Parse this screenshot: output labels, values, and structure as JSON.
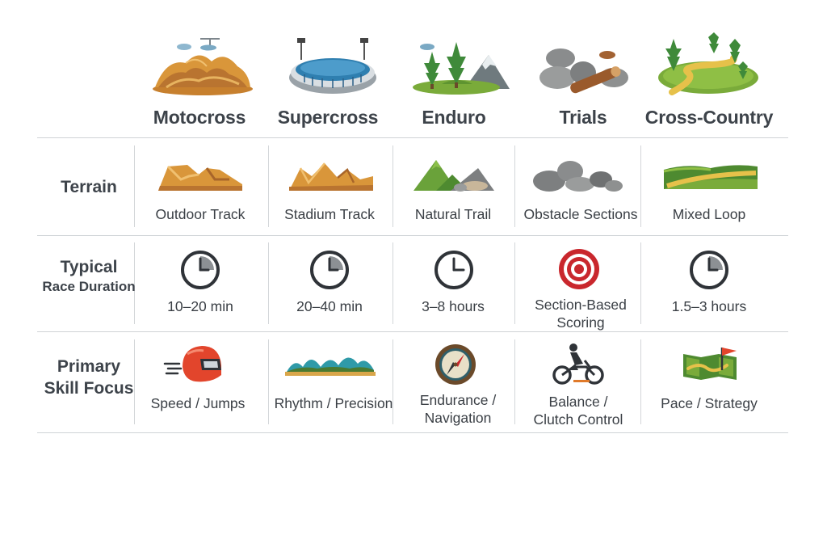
{
  "columns": [
    {
      "label": "Motocross",
      "icon": "dirt-hills-icon"
    },
    {
      "label": "Supercross",
      "icon": "stadium-icon"
    },
    {
      "label": "Enduro",
      "icon": "mountain-forest-icon"
    },
    {
      "label": "Trials",
      "icon": "rocks-logs-icon"
    },
    {
      "label": "Cross-Country",
      "icon": "winding-path-icon"
    }
  ],
  "rows": {
    "terrain": {
      "label": "Terrain",
      "cells": [
        {
          "text": "Outdoor Track",
          "icon": "dirt-track-icon"
        },
        {
          "text": "Stadium Track",
          "icon": "stadium-track-icon"
        },
        {
          "text": "Natural Trail",
          "icon": "natural-trail-icon"
        },
        {
          "text": "Obstacle Sections",
          "icon": "rocks-icon"
        },
        {
          "text": "Mixed Loop",
          "icon": "mixed-loop-icon"
        }
      ]
    },
    "duration": {
      "label_line1": "Typical",
      "label_line2": "Race Duration",
      "cells": [
        {
          "text": "10–20 min",
          "icon": "clock-icon"
        },
        {
          "text": "20–40 min",
          "icon": "clock-icon"
        },
        {
          "text": "3–8 hours",
          "icon": "clock-icon"
        },
        {
          "text_line1": "Section-Based",
          "text_line2": "Scoring",
          "icon": "target-icon"
        },
        {
          "text": "1.5–3 hours",
          "icon": "clock-icon"
        }
      ]
    },
    "skill": {
      "label_line1": "Primary",
      "label_line2": "Skill Focus",
      "cells": [
        {
          "text": "Speed / Jumps",
          "icon": "helmet-icon"
        },
        {
          "text": "Rhythm / Precision",
          "icon": "whoops-icon"
        },
        {
          "text_line1": "Endurance /",
          "text_line2": "Navigation",
          "icon": "compass-icon"
        },
        {
          "text_line1": "Balance /",
          "text_line2": "Clutch Control",
          "icon": "motorcycle-rider-icon"
        },
        {
          "text": "Pace / Strategy",
          "icon": "map-flag-icon"
        }
      ]
    }
  },
  "colors": {
    "dirt": "#d9963a",
    "dirt_dark": "#a8652a",
    "green": "#7aab3a",
    "tree": "#3f8a3a",
    "rock": "#7d7f80",
    "clock": "#2f3338",
    "target": "#c9272d",
    "helmet": "#e2452c",
    "stadium_blue": "#2f7fb0",
    "line": "#cfd3d6"
  }
}
